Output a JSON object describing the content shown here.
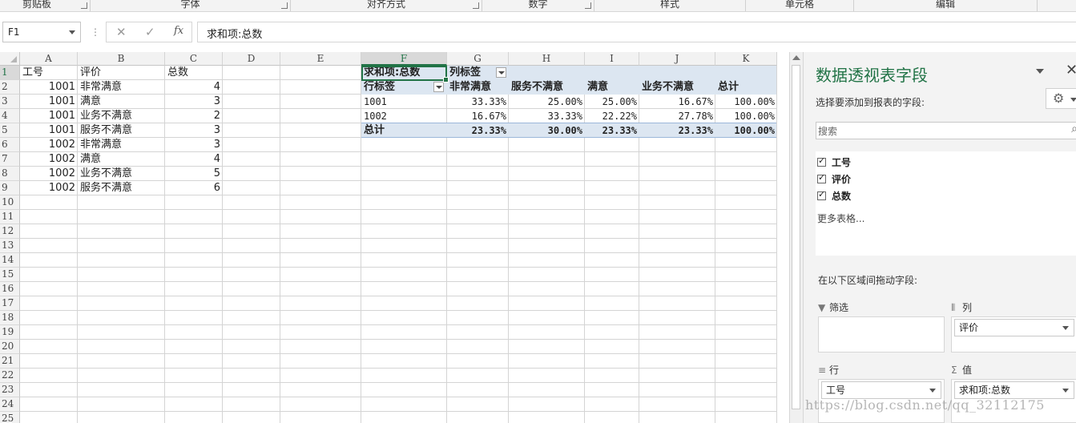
{
  "ribbon": {
    "groups": [
      "剪贴板",
      "字体",
      "对齐方式",
      "数字",
      "样式",
      "单元格",
      "编辑"
    ]
  },
  "formula_bar": {
    "name_box": "F1",
    "cancel_icon": "✕",
    "enter_icon": "✓",
    "fx_label": "fx",
    "content": "求和项:总数"
  },
  "sheet": {
    "columns": [
      "A",
      "B",
      "C",
      "D",
      "E",
      "F",
      "G",
      "H",
      "I",
      "J",
      "K"
    ],
    "rows": [
      "1",
      "2",
      "3",
      "4",
      "5",
      "6",
      "7",
      "8",
      "9",
      "10",
      "11",
      "12",
      "13",
      "14",
      "15",
      "16",
      "17",
      "18",
      "19",
      "20",
      "21",
      "22",
      "23",
      "24",
      "25"
    ],
    "selected_cell": "F1",
    "source_table": {
      "headers": [
        "工号",
        "评价",
        "总数"
      ],
      "rows": [
        [
          "1001",
          "非常满意",
          "4"
        ],
        [
          "1001",
          "满意",
          "3"
        ],
        [
          "1001",
          "业务不满意",
          "2"
        ],
        [
          "1001",
          "服务不满意",
          "3"
        ],
        [
          "1002",
          "非常满意",
          "3"
        ],
        [
          "1002",
          "满意",
          "4"
        ],
        [
          "1002",
          "业务不满意",
          "5"
        ],
        [
          "1002",
          "服务不满意",
          "6"
        ]
      ]
    },
    "pivot": {
      "value_label": "求和项:总数",
      "column_label": "列标签",
      "row_label": "行标签",
      "column_headers": [
        "非常满意",
        "服务不满意",
        "满意",
        "业务不满意",
        "总计"
      ],
      "rows": [
        {
          "label": "1001",
          "values": [
            "33.33%",
            "25.00%",
            "25.00%",
            "16.67%",
            "100.00%"
          ]
        },
        {
          "label": "1002",
          "values": [
            "16.67%",
            "33.33%",
            "22.22%",
            "27.78%",
            "100.00%"
          ]
        }
      ],
      "total": {
        "label": "总计",
        "values": [
          "23.33%",
          "30.00%",
          "23.33%",
          "23.33%",
          "100.00%"
        ]
      }
    }
  },
  "pane": {
    "title": "数据透视表字段",
    "close_icon": "✕",
    "subtitle": "选择要添加到报表的字段:",
    "search_placeholder": "搜索",
    "fields": [
      {
        "name": "工号",
        "checked": true
      },
      {
        "name": "评价",
        "checked": true
      },
      {
        "name": "总数",
        "checked": true
      }
    ],
    "more_tables": "更多表格...",
    "drag_message": "在以下区域间拖动字段:",
    "zones": {
      "filter": {
        "title": "筛选",
        "icon": "filter-icon"
      },
      "columns": {
        "title": "列",
        "icon": "columns-icon",
        "item": "评价"
      },
      "rows": {
        "title": "行",
        "icon": "rows-icon",
        "item": "工号"
      },
      "values": {
        "title": "值",
        "icon": "sigma-icon",
        "item": "求和项:总数"
      }
    }
  },
  "watermark": "https://blog.csdn.net/qq_32112175"
}
